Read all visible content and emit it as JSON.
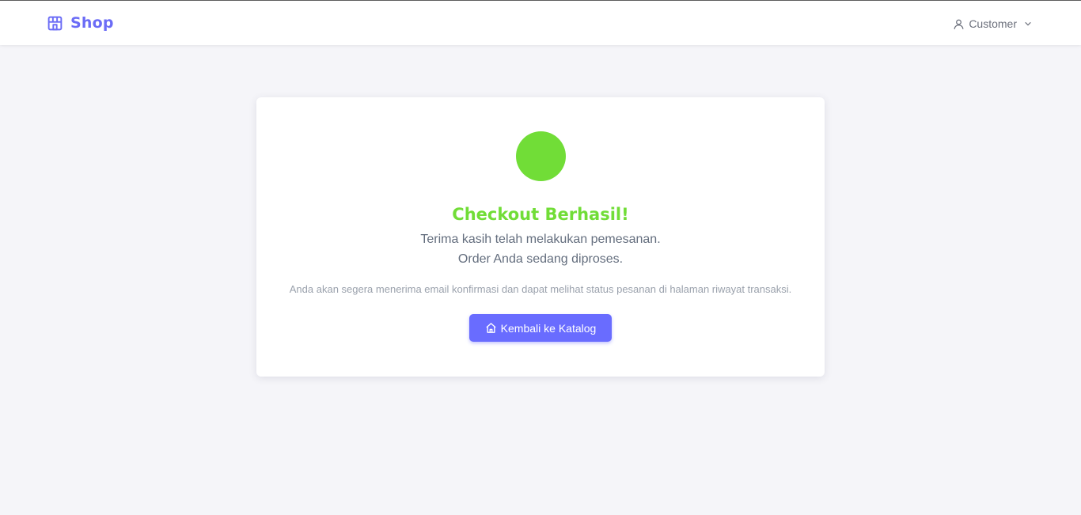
{
  "navbar": {
    "brand_icon": "storefront-icon",
    "brand_text": "Shop",
    "user_icon": "user-icon",
    "user_label": "Customer",
    "dropdown_icon": "chevron-down-icon"
  },
  "card": {
    "status_icon": "success-circle",
    "title": "Checkout Berhasil!",
    "subtitle_line1": "Terima kasih telah melakukan pemesanan.",
    "subtitle_line2": "Order Anda sedang diproses.",
    "note": "Anda akan segera menerima email konfirmasi dan dapat melihat status pesanan di halaman riwayat transaksi.",
    "button_icon": "home-icon",
    "button_label": "Kembali ke Katalog"
  },
  "colors": {
    "accent": "#696cff",
    "brand": "#6b6cf6",
    "success": "#71dd37",
    "background": "#f5f5f9",
    "text_muted": "#646e7e"
  }
}
